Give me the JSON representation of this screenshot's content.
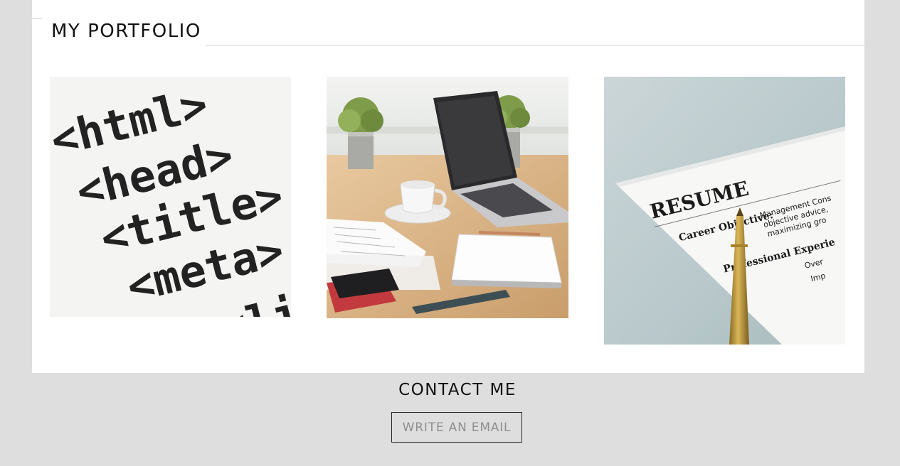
{
  "portfolio": {
    "title": "MY PORTFOLIO",
    "items": [
      {
        "image": "html-code-printout",
        "code_lines": [
          "<html>",
          "<head>",
          "<title>",
          "<meta>",
          "<li"
        ]
      },
      {
        "image": "laptop-coffee-desk-photo"
      },
      {
        "image": "resume-document-with-pen",
        "resume_heading": "RESUME",
        "resume_subheading": "Career Objective:",
        "resume_body": [
          "Management Cons",
          "objective advice,",
          "maximizing gro"
        ],
        "resume_section": "Professional Experie",
        "resume_bullets": [
          "Over",
          "Imp"
        ]
      }
    ]
  },
  "contact": {
    "title": "CONTACT ME",
    "button_label": "WRITE AN EMAIL"
  },
  "colors": {
    "page_background": "#dedede",
    "panel_background": "#ffffff",
    "divider": "#cfcfcf",
    "heading_text": "#111111",
    "button_text": "#8f8f8f",
    "button_border": "#222222"
  }
}
